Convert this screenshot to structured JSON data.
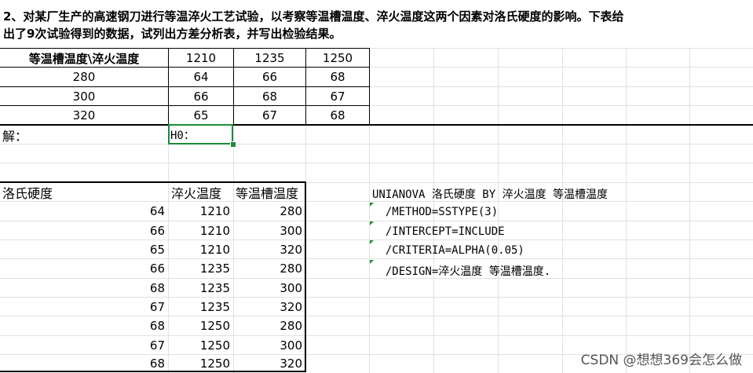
{
  "problem": {
    "line1": "2、对某厂生产的高速钢刀进行等温淬火工艺试验，以考察等温槽温度、淬火温度这两个因素对洛氏硬度的影响。下表给",
    "line2": "出了9次试验得到的数据，试列出方差分析表，并写出检验结果。"
  },
  "table1": {
    "header": [
      "等温槽温度\\淬火温度",
      "1210",
      "1235",
      "1250"
    ],
    "rows": [
      [
        "280",
        "64",
        "66",
        "68"
      ],
      [
        "300",
        "66",
        "68",
        "67"
      ],
      [
        "320",
        "65",
        "67",
        "68"
      ]
    ]
  },
  "solution": {
    "label": "解：",
    "h0": "H0："
  },
  "table2": {
    "header": [
      "洛氏硬度",
      "淬火温度",
      "等温槽温度"
    ],
    "rows": [
      [
        "64",
        "1210",
        "280"
      ],
      [
        "66",
        "1210",
        "300"
      ],
      [
        "65",
        "1210",
        "320"
      ],
      [
        "66",
        "1235",
        "280"
      ],
      [
        "68",
        "1235",
        "300"
      ],
      [
        "67",
        "1235",
        "320"
      ],
      [
        "68",
        "1250",
        "280"
      ],
      [
        "67",
        "1250",
        "300"
      ],
      [
        "68",
        "1250",
        "320"
      ]
    ]
  },
  "syntax": [
    "UNIANOVA 洛氏硬度 BY 淬火温度 等温槽温度",
    "  /METHOD=SSTYPE(3)",
    "  /INTERCEPT=INCLUDE",
    "  /CRITERIA=ALPHA(0.05)",
    "  /DESIGN=淬火温度 等温槽温度."
  ],
  "watermark": "CSDN @想想369会怎么做",
  "colors": {
    "selection": "#1e8b3a",
    "gridline": "#e1e1e1"
  }
}
